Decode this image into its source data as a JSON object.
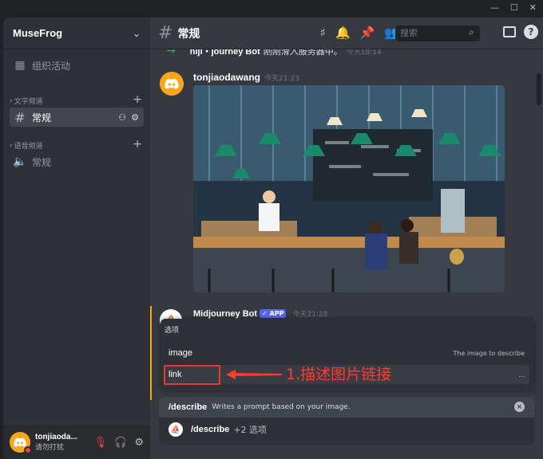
{
  "window": {
    "minimize": "—",
    "maximize": "☐",
    "close": "✕"
  },
  "server": {
    "name": "MuseFrog"
  },
  "sidebar": {
    "activity": "组织活动",
    "text_category": "文字频道",
    "text_channel": "常规",
    "voice_category": "语音频道",
    "voice_channel": "常规"
  },
  "user": {
    "name": "tonjiaoda...",
    "status": "请勿打扰"
  },
  "header": {
    "channel": "常规",
    "search_placeholder": "搜索"
  },
  "messages": {
    "sys_user": "niji・journey Bot",
    "sys_text": "刚刚滑入服务器中。",
    "sys_time": "今天18:14",
    "user1_name": "tonjiaodawang",
    "user1_time": "今天21:23",
    "mj_name": "Midjourney Bot",
    "mj_badge": "✓ APP",
    "mj_time": "今天21:28"
  },
  "popup": {
    "title": "选项",
    "options": [
      {
        "name": "image",
        "desc": "The image to describe"
      },
      {
        "name": "link",
        "desc": "..."
      }
    ]
  },
  "annotation": "1.描述图片链接",
  "command": {
    "name": "/describe",
    "desc": "Writes a prompt based on your image.",
    "input_name": "/describe",
    "extra": "+2 选项"
  },
  "colors": {
    "accent": "#5865f2",
    "annotation_red": "#e53935",
    "dnd": "#ed4245",
    "avatar_orange": "#faa61a"
  }
}
